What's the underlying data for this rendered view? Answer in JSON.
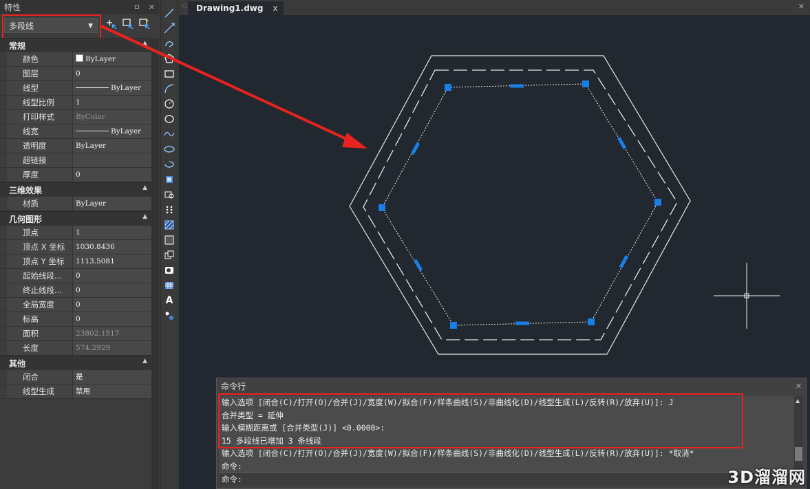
{
  "palette": {
    "title": "特性",
    "pin_glyph": "ㅁ",
    "close_glyph": "✕",
    "selected_type": "多段线",
    "sections": [
      {
        "name": "常规",
        "rows": [
          {
            "key": "颜色",
            "value": "ByLayer",
            "kind": "swatch"
          },
          {
            "key": "图层",
            "value": "0"
          },
          {
            "key": "线型",
            "value": "ByLayer",
            "kind": "line"
          },
          {
            "key": "线型比例",
            "value": "1"
          },
          {
            "key": "打印样式",
            "value": "ByColor",
            "dim": true
          },
          {
            "key": "线宽",
            "value": "ByLayer",
            "kind": "line"
          },
          {
            "key": "透明度",
            "value": "ByLayer"
          },
          {
            "key": "超链接",
            "value": ""
          },
          {
            "key": "厚度",
            "value": "0"
          }
        ]
      },
      {
        "name": "三维效果",
        "rows": [
          {
            "key": "材质",
            "value": "ByLayer"
          }
        ]
      },
      {
        "name": "几何图形",
        "rows": [
          {
            "key": "顶点",
            "value": "1"
          },
          {
            "key": "顶点 X 坐标",
            "value": "1030.8436"
          },
          {
            "key": "顶点 Y 坐标",
            "value": "1113.5081"
          },
          {
            "key": "起始线段...",
            "value": "0"
          },
          {
            "key": "终止线段...",
            "value": "0"
          },
          {
            "key": "全局宽度",
            "value": "0"
          },
          {
            "key": "标高",
            "value": "0"
          },
          {
            "key": "面积",
            "value": "23802.1517",
            "dim": true
          },
          {
            "key": "长度",
            "value": "574.2929",
            "dim": true
          }
        ]
      },
      {
        "name": "其他",
        "rows": [
          {
            "key": "闭合",
            "value": "是"
          },
          {
            "key": "线型生成",
            "value": "禁用"
          }
        ]
      }
    ]
  },
  "tab": {
    "label": "Drawing1.dwg",
    "close": "x"
  },
  "command": {
    "title": "命令行",
    "lines": [
      "输入选项 [闭合(C)/打开(O)/合并(J)/宽度(W)/拟合(F)/样条曲线(S)/非曲线化(D)/线型生成(L)/反转(R)/放弃(U)]: J",
      "合并类型 = 延伸",
      "输入模糊距离或 [合并类型(J)] <0.0000>:",
      "15 多段线已增加 3 条线段",
      "输入选项 [闭合(C)/打开(O)/合并(J)/宽度(W)/拟合(F)/样条曲线(S)/非曲线化(D)/线型生成(L)/反转(R)/放弃(U)]: *取消*",
      "命令:"
    ],
    "prompt": "命令:"
  },
  "watermark": "3D溜溜网",
  "colors": {
    "highlight": "#e8231f",
    "grip": "#1a7ee6",
    "canvas": "#212830"
  }
}
